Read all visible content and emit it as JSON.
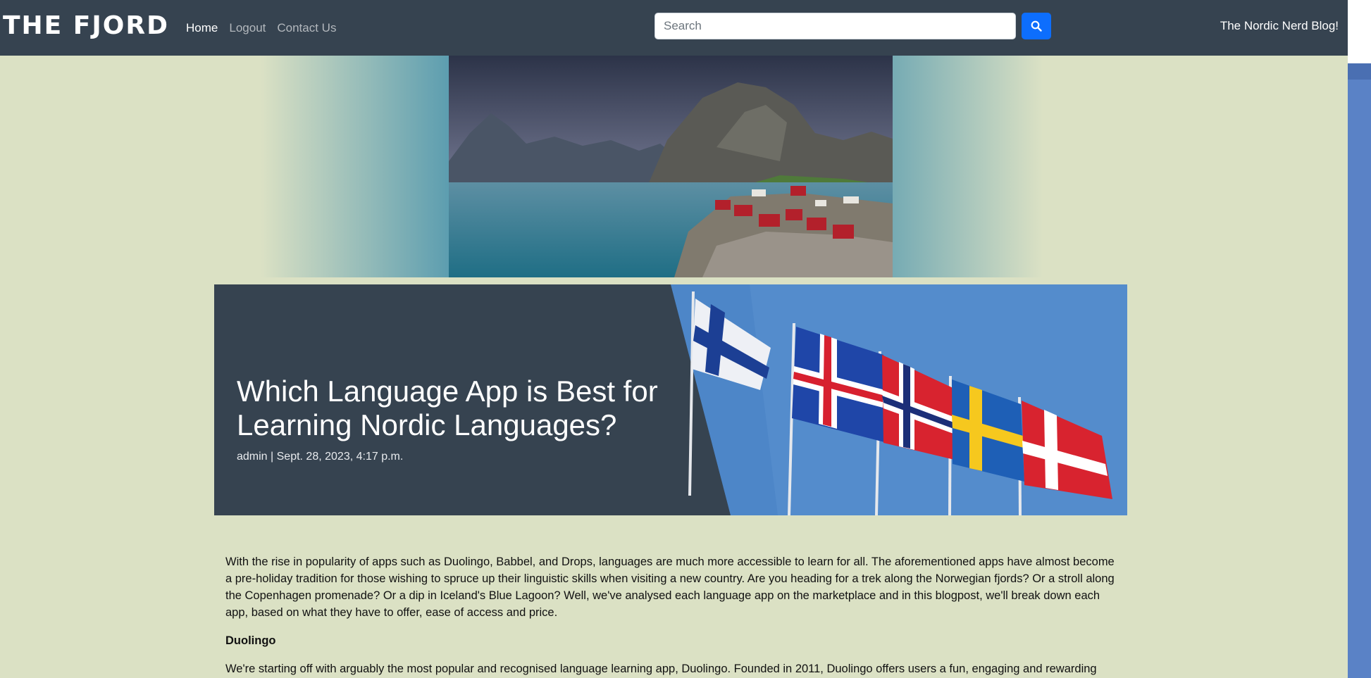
{
  "navbar": {
    "brand": "THE FJORD",
    "links": [
      {
        "label": "Home",
        "active": true
      },
      {
        "label": "Logout",
        "active": false
      },
      {
        "label": "Contact Us",
        "active": false
      }
    ],
    "search": {
      "placeholder": "Search",
      "value": ""
    },
    "search_icon": "search-icon",
    "blog_title": "The Nordic Nerd Blog!"
  },
  "hero": {
    "image": "norwegian-fjord-village-photo"
  },
  "post": {
    "title": "Which Language App is Best for Learning Nordic Languages?",
    "meta": "admin | Sept. 28, 2023, 4:17 p.m.",
    "image": "nordic-flags-photo",
    "intro": "With the rise in popularity of apps such as Duolingo, Babbel, and Drops, languages are much more accessible to learn for all. The aforementioned apps have almost become a pre-holiday tradition for those wishing to spruce up their linguistic skills when visiting a new country. Are you heading for a trek along the Norwegian fjords? Or a stroll along the Copenhagen promenade? Or a dip in Iceland's Blue Lagoon? Well, we've analysed each language app on the marketplace and in this blogpost, we'll break down each app, based on what they have to offer, ease of access and price.",
    "section_heading": "Duolingo",
    "section_text": "We're starting off with arguably the most popular and recognised language learning app, Duolingo. Founded in 2011, Duolingo offers users a fun, engaging and rewarding"
  },
  "colors": {
    "navbar_bg": "#364350",
    "page_bg": "#dbe1c4",
    "accent": "#0d6efd",
    "sidebar_strip": "#5a82c6"
  }
}
